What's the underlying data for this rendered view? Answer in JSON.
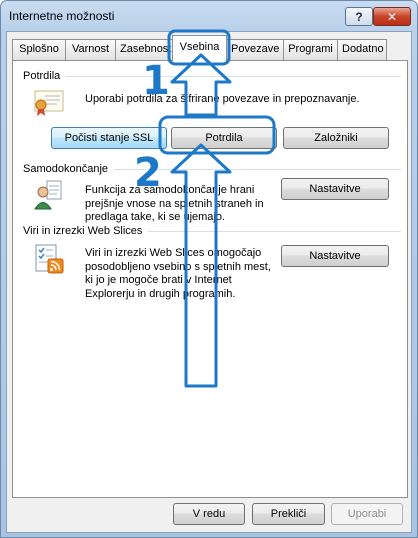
{
  "window": {
    "title": "Internetne možnosti",
    "help_label": "?",
    "close_label": "✕"
  },
  "tabs": [
    {
      "label": "Splošno"
    },
    {
      "label": "Varnost"
    },
    {
      "label": "Zasebnost"
    },
    {
      "label": "Vsebina",
      "active": true
    },
    {
      "label": "Povezave"
    },
    {
      "label": "Programi"
    },
    {
      "label": "Dodatno"
    }
  ],
  "certificates": {
    "heading": "Potrdila",
    "description": "Uporabi potrdila za šifrirane povezave in prepoznavanje.",
    "icon": "certificate-icon",
    "clear_ssl_label": "Počisti stanje SSL",
    "certificates_label": "Potrdila",
    "publishers_label": "Založniki"
  },
  "autocomplete": {
    "heading": "Samodokončanje",
    "description_lines": [
      "Funkcija za samodokončanje hrani",
      "prejšnje vnose na spletnih straneh in",
      "predlaga take, ki se ujemajo."
    ],
    "icon": "autocomplete-user-icon",
    "settings_label": "Nastavitve"
  },
  "feeds": {
    "heading": "Viri in izrezki Web Slices",
    "description_lines": [
      "Viri in izrezki Web Slices omogočajo",
      "posodobljeno vsebino s spletnih mest,",
      "ki jo je mogoče brati v Internet",
      "Explorerju in drugih programih."
    ],
    "icon": "feeds-icon",
    "settings_label": "Nastavitve"
  },
  "footer": {
    "ok_label": "V redu",
    "cancel_label": "Prekliči",
    "apply_label": "Uporabi"
  },
  "annotations": {
    "step1": "1",
    "step2": "2",
    "color": "#1e78c8"
  }
}
